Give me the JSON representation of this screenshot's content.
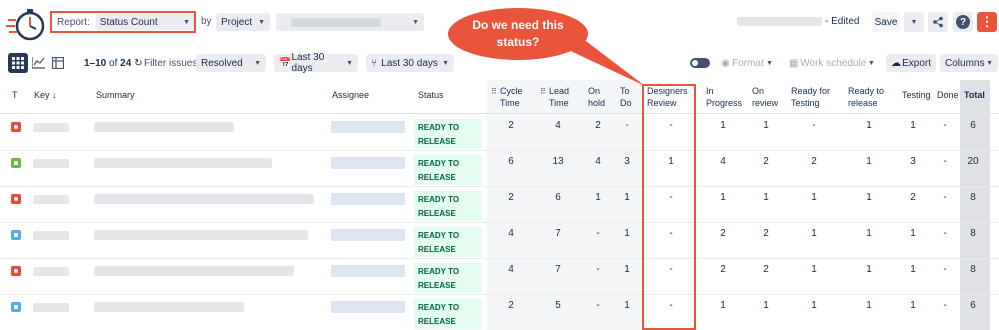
{
  "toolbar": {
    "report_label": "Report:",
    "report_value": "Status Count",
    "by_label": "by",
    "group_value": "Project",
    "edited_label": "- Edited",
    "save_label": "Save",
    "help_label": "?",
    "more_label": "⋮"
  },
  "callout": {
    "line1": "Do we need this",
    "line2": "status?"
  },
  "toolbar2": {
    "page_range": "1–10",
    "page_of": "of",
    "page_total": "24",
    "filter_label": "Filter issues:",
    "filter_value": "Resolved",
    "period1": "Last 30 days",
    "period2": "Last 30 days",
    "format_label": "Format",
    "work_schedule_label": "Work schedule",
    "export_label": "Export",
    "columns_label": "Columns"
  },
  "table": {
    "headers": {
      "t": "T",
      "key": "Key",
      "summary": "Summary",
      "assignee": "Assignee",
      "status": "Status",
      "cycle_time_1": "Cycle",
      "cycle_time_2": "Time",
      "lead_time_1": "Lead",
      "lead_time_2": "Time",
      "on_hold_1": "On",
      "on_hold_2": "hold",
      "to_do_1": "To",
      "to_do_2": "Do",
      "designers_review_1": "Designers",
      "designers_review_2": "Review",
      "in_progress_1": "In",
      "in_progress_2": "Progress",
      "on_review_1": "On",
      "on_review_2": "review",
      "ready_testing_1": "Ready for",
      "ready_testing_2": "Testing",
      "ready_release_1": "Ready to",
      "ready_release_2": "release",
      "testing": "Testing",
      "done": "Done",
      "total": "Total"
    },
    "status_line1": "READY TO",
    "status_line2": "RELEASE",
    "rows": [
      {
        "type": "bug",
        "cycle": "2",
        "lead": "4",
        "hold": "2",
        "todo": "-",
        "designers": "-",
        "inprog": "1",
        "onreview": "1",
        "readytest": "-",
        "readyrel": "1",
        "testing": "1",
        "done": "-",
        "total": "6"
      },
      {
        "type": "story",
        "cycle": "6",
        "lead": "13",
        "hold": "4",
        "todo": "3",
        "designers": "1",
        "inprog": "4",
        "onreview": "2",
        "readytest": "2",
        "readyrel": "1",
        "testing": "3",
        "done": "-",
        "total": "20"
      },
      {
        "type": "bug",
        "cycle": "2",
        "lead": "6",
        "hold": "1",
        "todo": "1",
        "designers": "-",
        "inprog": "1",
        "onreview": "1",
        "readytest": "1",
        "readyrel": "1",
        "testing": "2",
        "done": "-",
        "total": "8"
      },
      {
        "type": "task",
        "cycle": "4",
        "lead": "7",
        "hold": "-",
        "todo": "1",
        "designers": "-",
        "inprog": "2",
        "onreview": "2",
        "readytest": "1",
        "readyrel": "1",
        "testing": "1",
        "done": "-",
        "total": "8"
      },
      {
        "type": "bug",
        "cycle": "4",
        "lead": "7",
        "hold": "-",
        "todo": "1",
        "designers": "-",
        "inprog": "2",
        "onreview": "2",
        "readytest": "1",
        "readyrel": "1",
        "testing": "1",
        "done": "-",
        "total": "8"
      },
      {
        "type": "task",
        "cycle": "2",
        "lead": "5",
        "hold": "-",
        "todo": "1",
        "designers": "-",
        "inprog": "1",
        "onreview": "1",
        "readytest": "1",
        "readyrel": "1",
        "testing": "1",
        "done": "-",
        "total": "6"
      }
    ]
  },
  "colors": {
    "accent": "#e8553a",
    "bug": "#e5493a",
    "story": "#63ba3c",
    "task": "#4bade8",
    "status_bg": "#e3fcef",
    "status_text": "#006644"
  }
}
